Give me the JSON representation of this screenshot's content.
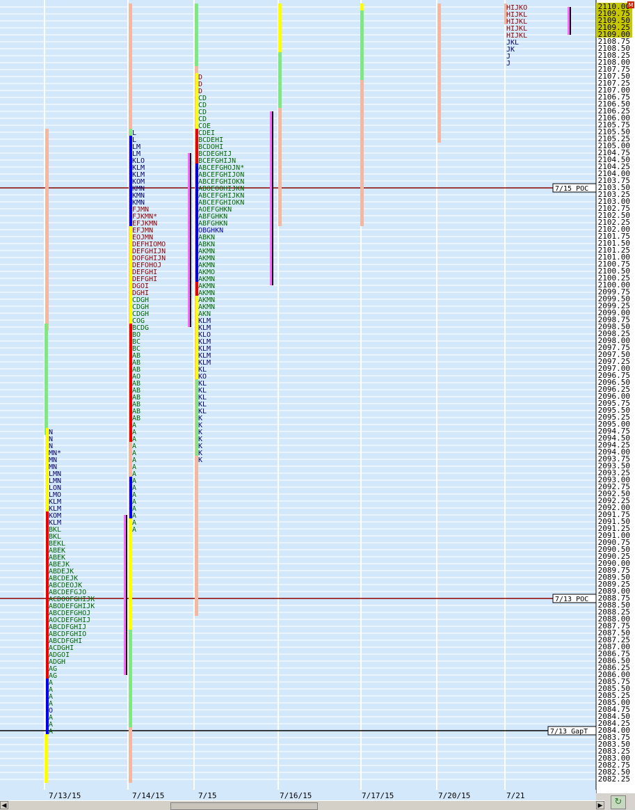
{
  "chart_data": {
    "type": "market-profile",
    "y_axis": {
      "min": 2082.25,
      "max": 2110.0,
      "step": 0.25,
      "current_price_box": [
        2110.0,
        2109.75,
        2109.5,
        2109.25,
        2109.0
      ],
      "corner_label": "M"
    },
    "x_axis": {
      "labels": [
        "7/13/15",
        "7/14/15",
        "7/15",
        "7/16/15",
        "7/17/15",
        "7/20/15",
        "7/21"
      ]
    },
    "reference_lines": [
      {
        "label": "7/15 POC",
        "price": 2103.5
      },
      {
        "label": "7/13 POC",
        "price": 2088.75
      },
      {
        "label": "7/13 GapT",
        "price": 2084.0
      }
    ],
    "sessions": [
      {
        "date": "7/13/15",
        "top": 2094.75,
        "rows": [
          "N",
          "N",
          "N",
          "MN*",
          "MN",
          "MN",
          "LMN",
          "LMN",
          "LON",
          "LMO",
          "KLM",
          "KLM",
          "KOM",
          "KLM",
          "BKL",
          "BKL",
          "BEKL",
          "ABEK",
          "ABEK",
          "ABEJK",
          "ABDEJK",
          "ABCDEJK",
          "ABCDEOJK",
          "ABCDEFGJO",
          "ACDOOFGHIJK",
          "ABODEFGHIJK",
          "ABCDEFGHOJ",
          "AOCDEFGHIJ",
          "ABCDFGHIJ",
          "ABCDFGHIO",
          "ABCDFGHI",
          "ACDGHI",
          "ADGOI",
          "ADGH",
          "AG",
          "AG",
          "A",
          "A",
          "A",
          "A",
          "O",
          "A",
          "A",
          "A"
        ],
        "profile_bars": [
          {
            "color": "#ffff00",
            "from": 2092.0,
            "to": 2094.75
          },
          {
            "color": "#ee0000",
            "from": 2086.0,
            "to": 2091.75
          },
          {
            "color": "#0000ee",
            "from": 2084.0,
            "to": 2085.75
          }
        ],
        "range_bars": [
          {
            "color": "#f4b8a0",
            "from": 2098.5,
            "to": 2105.5
          },
          {
            "color": "#80e880",
            "from": 2094.75,
            "to": 2098.5
          },
          {
            "color": "#ffff00",
            "from": 2082.25,
            "to": 2083.75
          }
        ]
      },
      {
        "date": "7/14/15",
        "top": 2105.5,
        "rows": [
          "L",
          "L",
          "LM",
          "LM",
          "KLO",
          "KLM",
          "KLM",
          "KOM",
          "KMN",
          "KMN",
          "KMN",
          "FJMN",
          "FJKMN*",
          "EFJKMN",
          "EFJMN",
          "EOJMN",
          "DEFHIOMO",
          "DEFGHIJN",
          "DOFGHIJN",
          "DEFOHOJ",
          "DEFGHI",
          "DEFGHI",
          "DGOI",
          "DGHI",
          "CDGH",
          "CDGH",
          "CDGH",
          "COG",
          "BCDG",
          "BO",
          "BC",
          "BC",
          "AB",
          "AB",
          "AB",
          "AO",
          "AB",
          "AB",
          "AB",
          "AB",
          "AB",
          "AB",
          "A",
          "A",
          "A",
          "A",
          "A",
          "A",
          "A",
          "A",
          "A",
          "A",
          "A",
          "A",
          "A",
          "A",
          "A",
          "A"
        ],
        "profile_bars": [
          {
            "color": "#80e880",
            "from": 2105.25,
            "to": 2105.5
          },
          {
            "color": "#0000ee",
            "from": 2102.25,
            "to": 2105.25
          },
          {
            "color": "#ffff00",
            "from": 2098.75,
            "to": 2102.0
          },
          {
            "color": "#ee0000",
            "from": 2094.5,
            "to": 2098.5
          },
          {
            "color": "#0000ee",
            "from": 2091.75,
            "to": 2093.0
          }
        ],
        "range_bars": [
          {
            "color": "#f4b8a0",
            "from": 2082.25,
            "to": 2110.0
          },
          {
            "color": "#80e880",
            "from": 2084.25,
            "to": 2091.5
          },
          {
            "color": "#ffff00",
            "from": 2087.75,
            "to": 2091.5
          }
        ]
      },
      {
        "date": "7/15",
        "top": 2107.5,
        "rows": [
          "D",
          "D",
          "D",
          "CD",
          "CD",
          "CD",
          "CD",
          "COE",
          "CDEI",
          "BCDEHI",
          "BCDOHI",
          "BCDEGHIJ",
          "BCEFGHIJN",
          "ABCEFGHOJN*",
          "ABCEFGHIJON",
          "ABCEFGHIOKN",
          "ABOEOOHIJKN",
          "ABCEFGHIJKN",
          "ABCEFGHIOKN",
          "AOEFGHKN",
          "ABFGHKN",
          "ABFGHKN",
          "OBGHKN",
          "ABKN",
          "ABKN",
          "AKMN",
          "AKMN",
          "AKMN",
          "AKMO",
          "AKMN",
          "AKMN",
          "AKMN",
          "AKMN",
          "AKMN",
          "AKN",
          "KLM",
          "KLM",
          "KLO",
          "KLM",
          "KLM",
          "KLM",
          "KLM",
          "KL",
          "KO",
          "KL",
          "KL",
          "KL",
          "KL",
          "KL",
          "K",
          "K",
          "K",
          "K",
          "K",
          "K",
          "K"
        ],
        "profile_bars": [
          {
            "color": "#ffff00",
            "from": 2105.75,
            "to": 2107.5
          },
          {
            "color": "#ee0000",
            "from": 2104.5,
            "to": 2105.5
          },
          {
            "color": "#0000ee",
            "from": 2099.75,
            "to": 2104.25
          },
          {
            "color": "#ee0000",
            "from": 2099.75,
            "to": 2100.0
          },
          {
            "color": "#ffff00",
            "from": 2096.75,
            "to": 2099.5
          },
          {
            "color": "#80e880",
            "from": 2094.0,
            "to": 2096.5
          }
        ],
        "range_bars": [
          {
            "color": "#80e880",
            "from": 2107.75,
            "to": 2110.0
          },
          {
            "color": "#f4b8a0",
            "from": 2088.25,
            "to": 2107.75
          }
        ]
      },
      {
        "date": "7/16/15",
        "top": 2106.25,
        "rows": [],
        "profile_bars": [],
        "range_bars": [
          {
            "color": "#ffff00",
            "from": 2108.25,
            "to": 2110.0
          },
          {
            "color": "#80e880",
            "from": 2106.25,
            "to": 2108.25
          },
          {
            "color": "#f4b8a0",
            "from": 2102.25,
            "to": 2106.25
          }
        ]
      },
      {
        "date": "7/17/15",
        "top": 2110.0,
        "rows": [],
        "profile_bars": [],
        "range_bars": [
          {
            "color": "#ffff00",
            "from": 2109.75,
            "to": 2110.0
          },
          {
            "color": "#80e880",
            "from": 2107.25,
            "to": 2109.75
          },
          {
            "color": "#f4b8a0",
            "from": 2102.25,
            "to": 2107.25
          }
        ]
      },
      {
        "date": "7/20/15",
        "top": 2110.0,
        "rows": [],
        "profile_bars": [],
        "range_bars": [
          {
            "color": "#f4b8a0",
            "from": 2105.25,
            "to": 2110.0
          }
        ]
      },
      {
        "date": "7/21",
        "top": 2110.0,
        "rows": [
          "HIJKO",
          "HIJKL",
          "HIJKL",
          "HIJKL",
          "HIJKL",
          "JKL",
          "JK",
          "J",
          "J"
        ],
        "profile_bars": [
          {
            "color": "#f4b8a0",
            "from": 2109.5,
            "to": 2110.0
          }
        ],
        "range_bars": []
      }
    ]
  }
}
